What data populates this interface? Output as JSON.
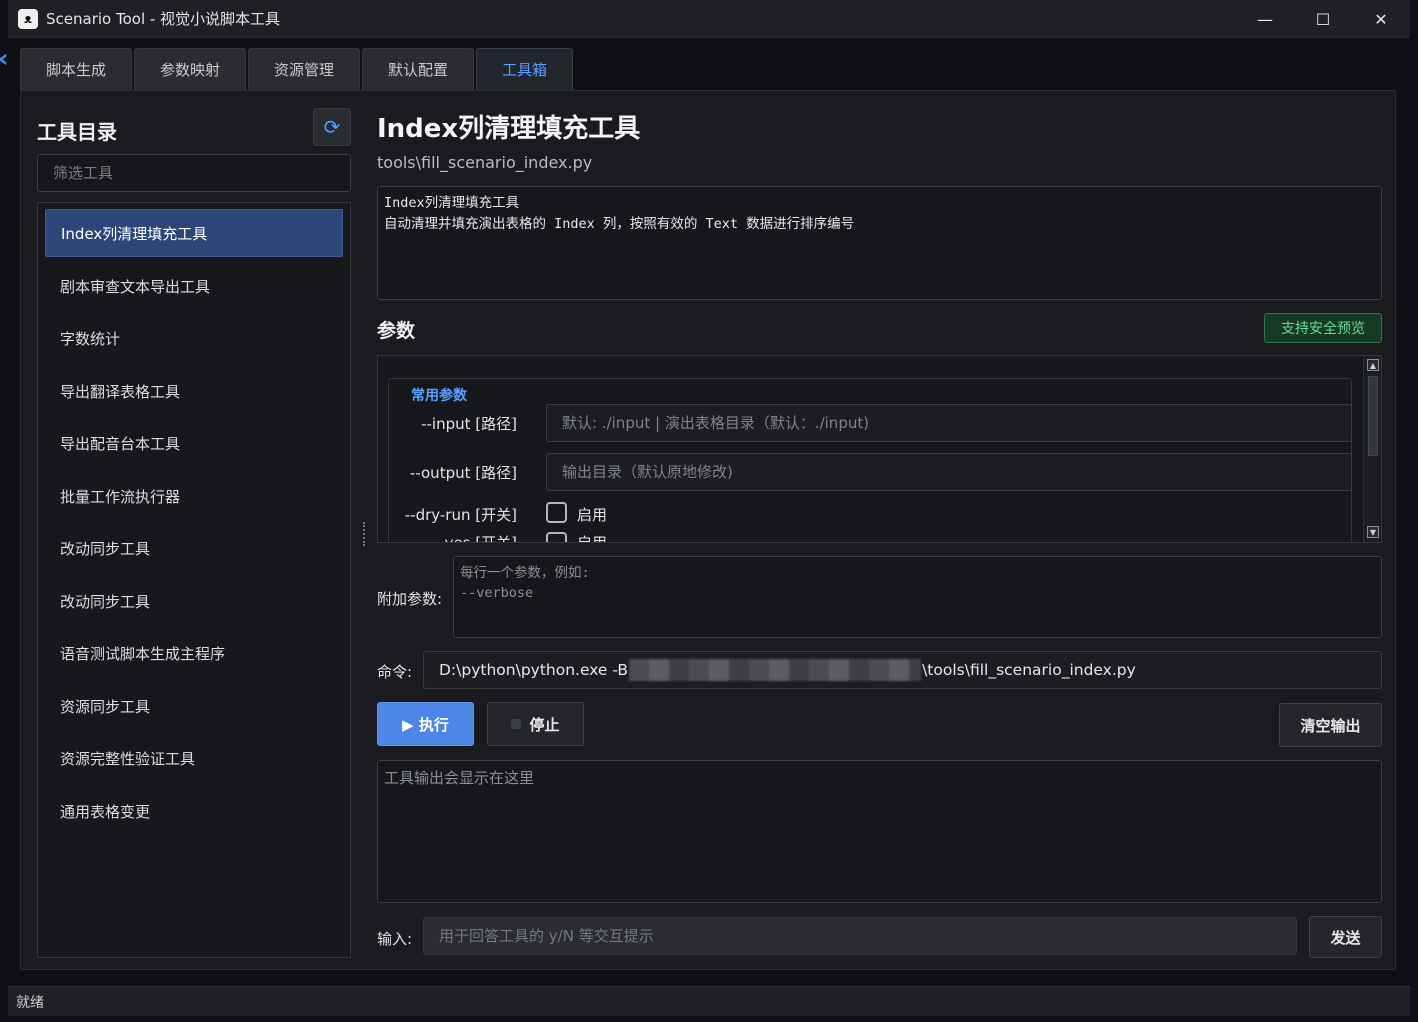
{
  "window": {
    "title": "Scenario Tool - 视觉小说脚本工具",
    "minimize": "—",
    "maximize": "☐",
    "close": "✕"
  },
  "tabs": [
    {
      "label": "脚本生成",
      "active": false
    },
    {
      "label": "参数映射",
      "active": false
    },
    {
      "label": "资源管理",
      "active": false
    },
    {
      "label": "默认配置",
      "active": false
    },
    {
      "label": "工具箱",
      "active": true
    }
  ],
  "sidebar": {
    "title": "工具目录",
    "refresh_icon": "refresh-icon",
    "filter_placeholder": "筛选工具",
    "items": [
      {
        "label": "Index列清理填充工具",
        "selected": true
      },
      {
        "label": "剧本审查文本导出工具",
        "selected": false
      },
      {
        "label": "字数统计",
        "selected": false
      },
      {
        "label": "导出翻译表格工具",
        "selected": false
      },
      {
        "label": "导出配音台本工具",
        "selected": false
      },
      {
        "label": "批量工作流执行器",
        "selected": false
      },
      {
        "label": "改动同步工具",
        "selected": false
      },
      {
        "label": "改动同步工具",
        "selected": false
      },
      {
        "label": "语音测试脚本生成主程序",
        "selected": false
      },
      {
        "label": "资源同步工具",
        "selected": false
      },
      {
        "label": "资源完整性验证工具",
        "selected": false
      },
      {
        "label": "通用表格变更",
        "selected": false
      }
    ]
  },
  "tool": {
    "title": "Index列清理填充工具",
    "path": "tools\\fill_scenario_index.py",
    "description_line1": "Index列清理填充工具",
    "description_line2": "自动清理并填充演出表格的 Index 列，按照有效的 Text 数据进行排序编号"
  },
  "params": {
    "title": "参数",
    "safe_preview_badge": "支持安全预览",
    "group_label": "常用参数",
    "input_label": "--input",
    "input_type": "[路径]",
    "input_placeholder": "默认: ./input | 演出表格目录（默认：./input)",
    "output_label": "--output",
    "output_type": "[路径]",
    "output_placeholder": "输出目录（默认原地修改)",
    "dry_run_label": "--dry-run",
    "dry_run_type": "[开关]",
    "dry_run_check": "启用",
    "yes_label": "--yes",
    "yes_type": "[开关]",
    "yes_check": "启用"
  },
  "extra": {
    "label": "附加参数:",
    "placeholder": "每行一个参数，例如:\n--verbose"
  },
  "command": {
    "label": "命令:",
    "prefix": "D:\\python\\python.exe -B",
    "suffix": "\\tools\\fill_scenario_index.py"
  },
  "actions": {
    "run": "▶ 执行",
    "stop": "停止",
    "clear": "清空输出"
  },
  "output": {
    "placeholder": "工具输出会显示在这里"
  },
  "stdin": {
    "label": "输入:",
    "placeholder": "用于回答工具的 y/N 等交互提示",
    "send": "发送"
  },
  "status": {
    "text": "就绪"
  }
}
